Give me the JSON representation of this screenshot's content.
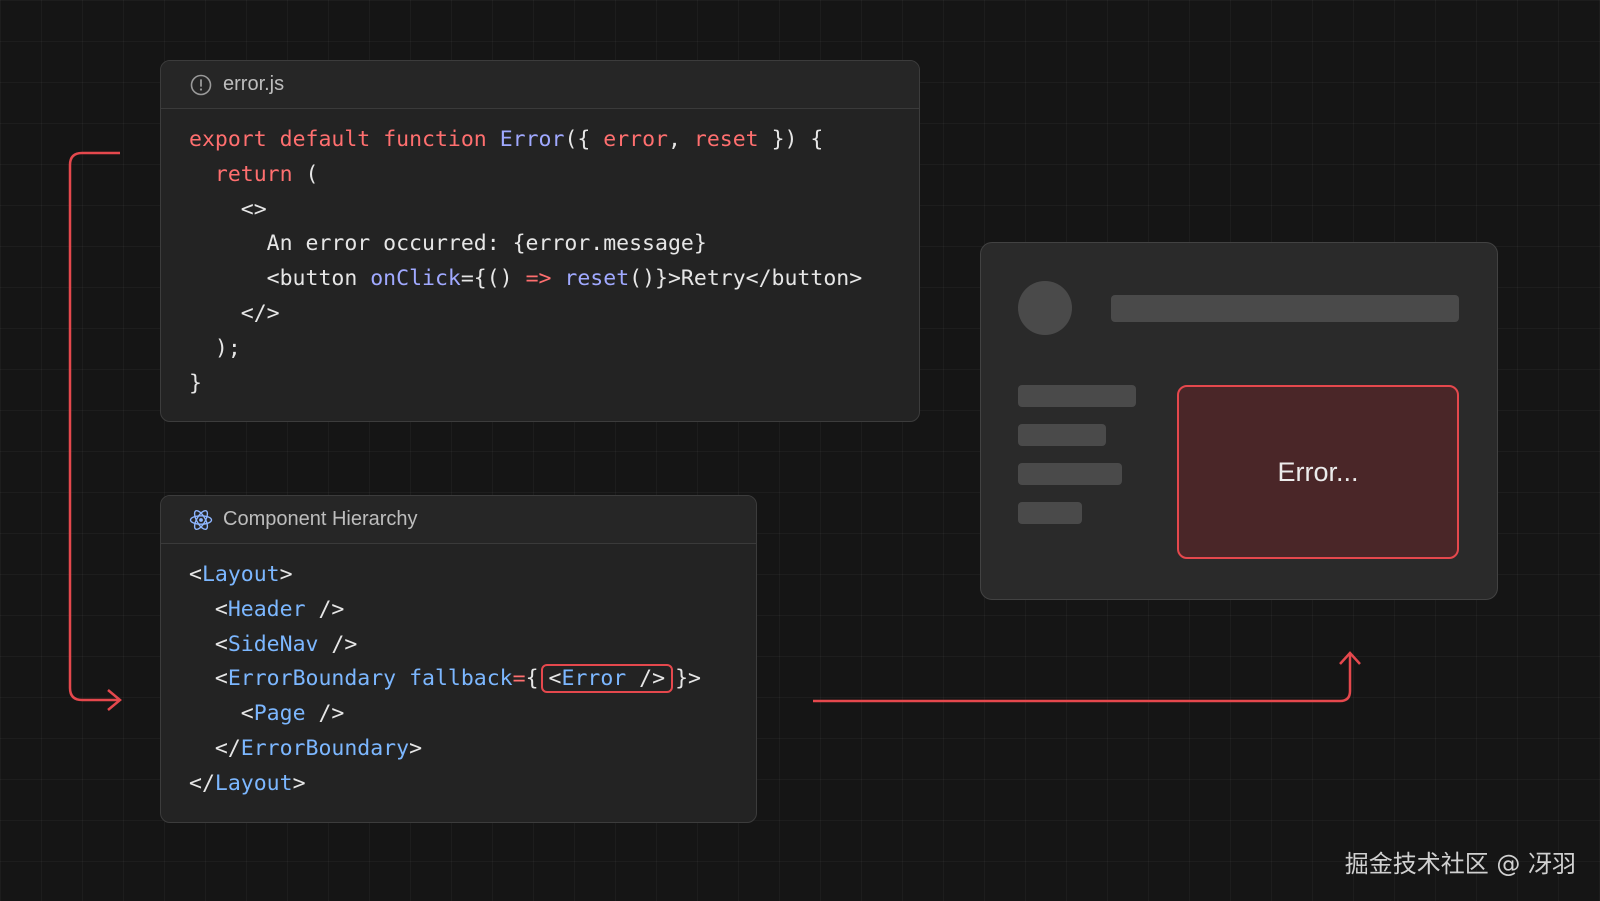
{
  "error_card": {
    "title": "error.js",
    "icon": "alert-circle-icon",
    "code": {
      "l1_export": "export",
      "l1_default": "default",
      "l1_function": "function",
      "l1_name": "Error",
      "l1_open": "({ ",
      "l1_error": "error",
      "l1_comma": ", ",
      "l1_reset": "reset",
      "l1_close": " }) {",
      "l2_return": "return",
      "l2_paren": " (",
      "l3": "<>",
      "l4": "An error occurred: {error.message}",
      "l5_open": "<button ",
      "l5_onclick": "onClick",
      "l5_eq": "={() ",
      "l5_arrow": "=>",
      "l5_reset": "reset",
      "l5_rest": "()}>Retry</button>",
      "l6": "</>",
      "l7": ");",
      "l8": "}"
    }
  },
  "hierarchy_card": {
    "title": "Component Hierarchy",
    "icon": "react-atom-icon",
    "lines": {
      "layout": "Layout",
      "header": "Header",
      "sidenav": "SideNav",
      "errorboundary": "ErrorBoundary",
      "fallback": "fallback",
      "error": "Error",
      "page": "Page",
      "errorboundary_close": "ErrorBoundary",
      "layout_close": "Layout"
    }
  },
  "preview": {
    "error_text": "Error..."
  },
  "colors": {
    "accent_red": "#e5484d",
    "keyword": "#ff6f6f",
    "function": "#a0a9ff",
    "tag": "#7cb7ff"
  },
  "watermark": "掘金技术社区 @ 冴羽"
}
